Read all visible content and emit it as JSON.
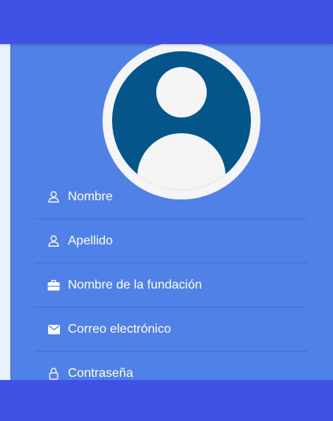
{
  "form": {
    "fields": [
      {
        "label": "Nombre",
        "icon": "person-outline-icon"
      },
      {
        "label": "Apellido",
        "icon": "person-outline-icon"
      },
      {
        "label": "Nombre de la fundación",
        "icon": "briefcase-icon"
      },
      {
        "label": "Correo electrónico",
        "icon": "envelope-icon"
      },
      {
        "label": "Contraseña",
        "icon": "lock-icon"
      }
    ]
  },
  "colors": {
    "appbar": "#4052e6",
    "card": "#5081e6",
    "avatar_bg": "#04568a",
    "text": "#ffffff"
  }
}
